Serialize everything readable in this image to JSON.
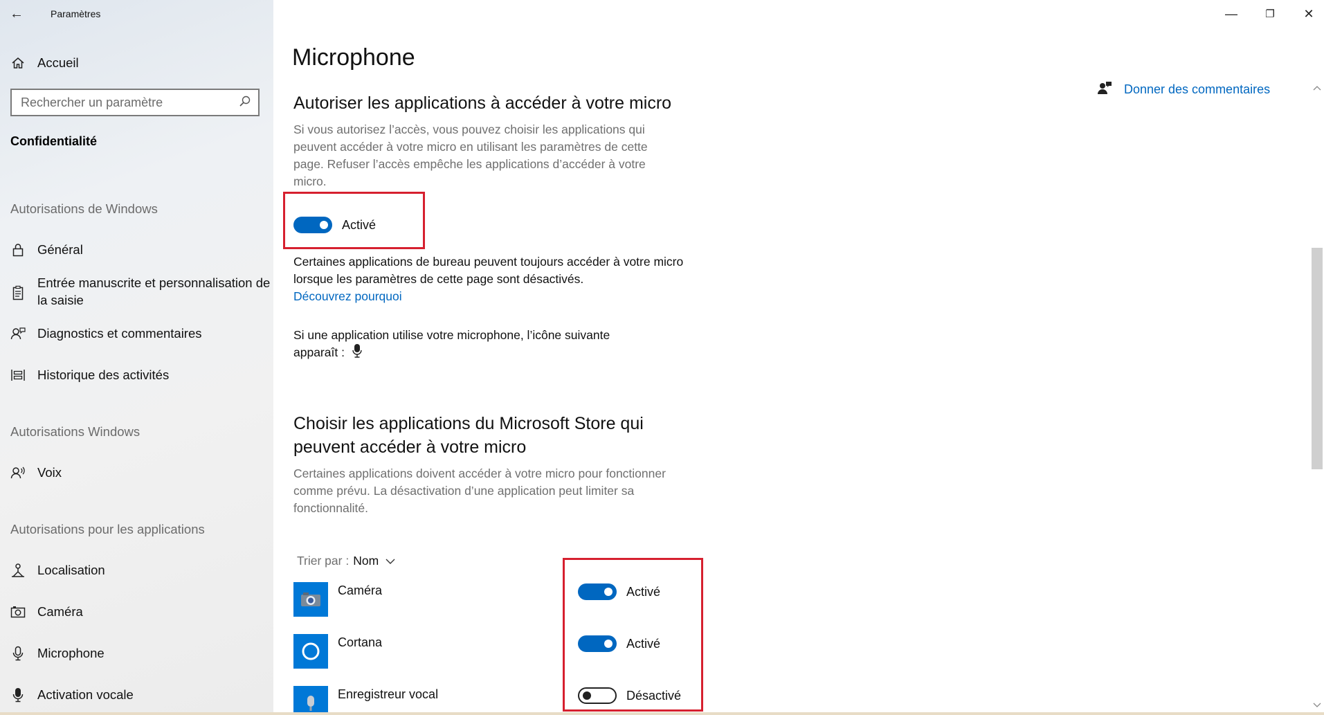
{
  "window": {
    "app_title": "Paramètres",
    "controls": {
      "minimize": "—",
      "maximize": "❐",
      "close": "✕"
    }
  },
  "sidebar": {
    "home_label": "Accueil",
    "search": {
      "placeholder": "Rechercher un paramètre",
      "value": ""
    },
    "section_label": "Confidentialité",
    "groups": [
      {
        "title": "Autorisations de Windows",
        "items": [
          {
            "label": "Général",
            "icon": "lock-icon"
          },
          {
            "label": "Entrée manuscrite et personnalisation de la saisie",
            "icon": "clipboard-icon"
          },
          {
            "label": "Diagnostics et commentaires",
            "icon": "person-feedback-icon"
          },
          {
            "label": "Historique des activités",
            "icon": "activity-history-icon"
          }
        ]
      },
      {
        "title": "Autorisations Windows",
        "items": [
          {
            "label": "Voix",
            "icon": "voice-icon"
          }
        ]
      },
      {
        "title": "Autorisations pour les applications",
        "items": [
          {
            "label": "Localisation",
            "icon": "location-icon"
          },
          {
            "label": "Caméra",
            "icon": "camera-icon"
          },
          {
            "label": "Microphone",
            "icon": "microphone-icon"
          },
          {
            "label": "Activation vocale",
            "icon": "voice-activation-icon"
          }
        ]
      }
    ]
  },
  "main": {
    "title": "Microphone",
    "feedback_label": "Donner des commentaires",
    "allow_section": {
      "heading": "Autoriser les applications à accéder à votre micro",
      "description": "Si vous autorisez l’accès, vous pouvez choisir les applications qui peuvent accéder à votre micro en utilisant les paramètres de cette page. Refuser l’accès empêche les applications d’accéder à votre micro.",
      "toggle_state": "Activé",
      "toggle_on": true,
      "desktop_note": "Certaines applications de bureau peuvent toujours accéder à votre micro lorsque les paramètres de cette page sont désactivés.",
      "learn_link": "Découvrez pourquoi",
      "icon_note": "Si une application utilise votre microphone, l’icône suivante apparaît :"
    },
    "store_section": {
      "heading_line1": "Choisir les applications du Microsoft Store qui",
      "heading_line2": "peuvent accéder à votre micro",
      "description": "Certaines applications doivent accéder à votre micro pour fonctionner comme prévu. La désactivation d’une application peut limiter sa fonctionnalité.",
      "sort_prefix": "Trier par :",
      "sort_value": "Nom",
      "apps": [
        {
          "name": "Caméra",
          "state": "Activé",
          "on": true,
          "icon": "camera-app-icon"
        },
        {
          "name": "Cortana",
          "state": "Activé",
          "on": true,
          "icon": "cortana-icon"
        },
        {
          "name": "Enregistreur vocal",
          "state": "Désactivé",
          "on": false,
          "icon": "voice-recorder-icon"
        }
      ]
    }
  },
  "colors": {
    "accent": "#0067c0",
    "highlight_box": "#d6202f",
    "tile": "#0078d7"
  }
}
